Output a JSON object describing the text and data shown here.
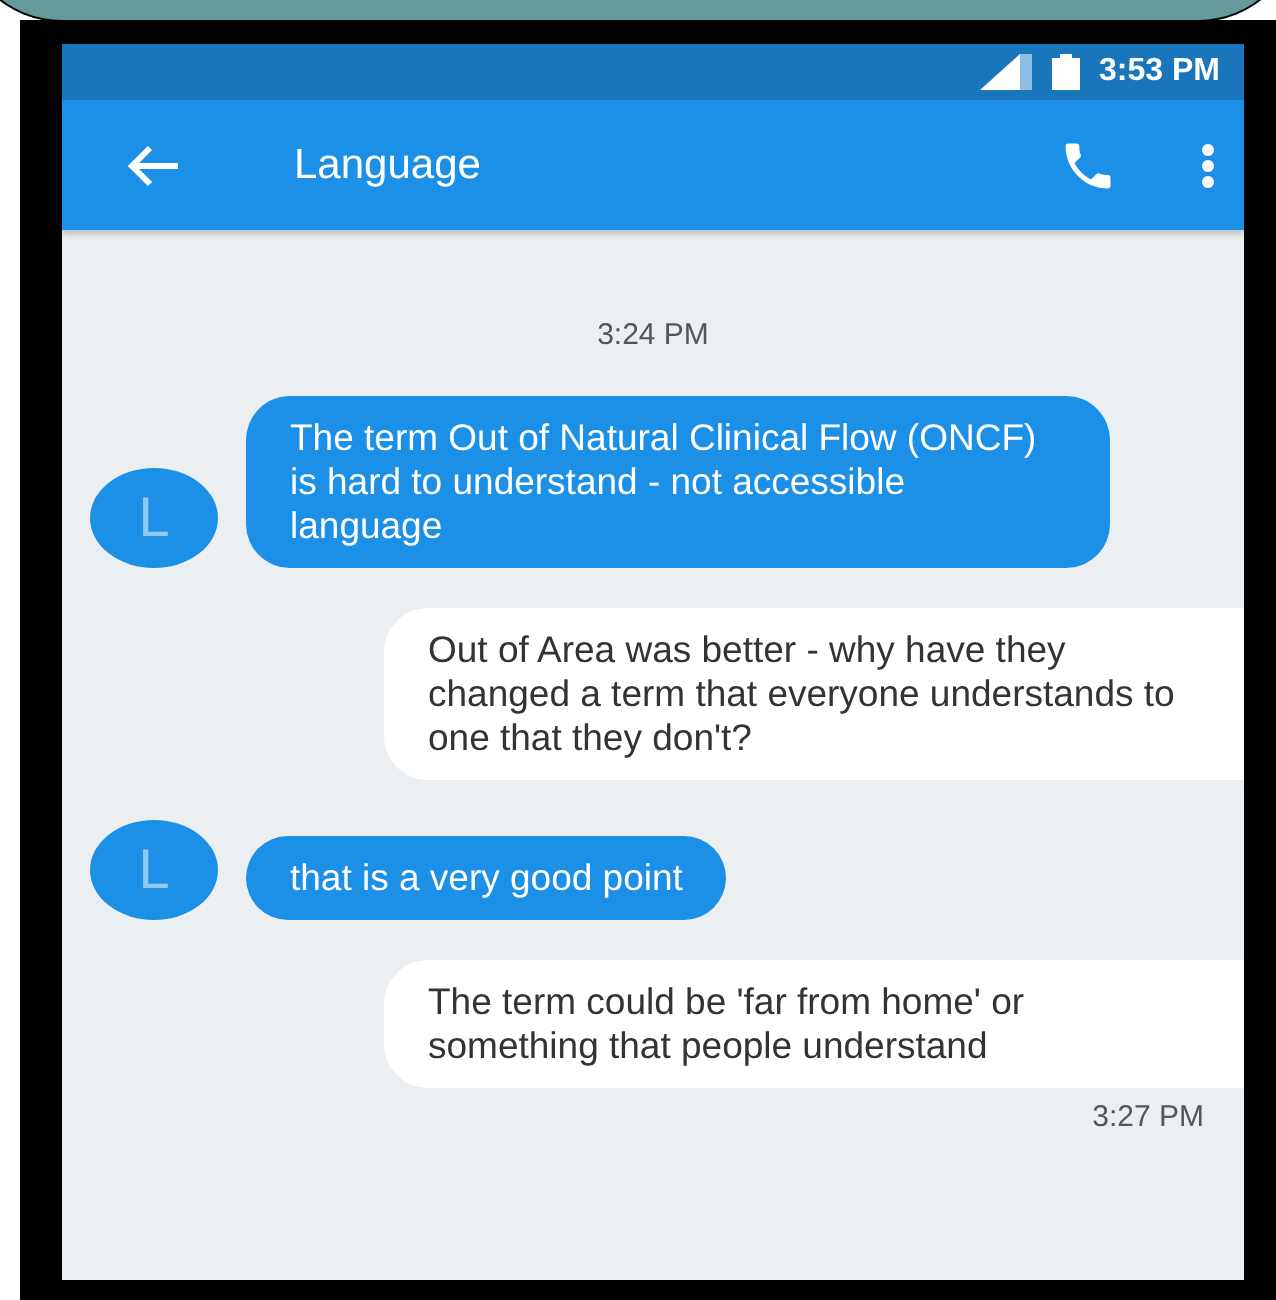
{
  "status_bar": {
    "time": "3:53 PM"
  },
  "app_bar": {
    "title": "Language"
  },
  "messages": [
    {
      "kind": "time",
      "text": "3:24 PM"
    },
    {
      "kind": "incoming",
      "avatar": "L",
      "text": "The term Out of Natural Clinical Flow (ONCF) is hard to understand - not accessible language"
    },
    {
      "kind": "outgoing",
      "text": "Out of Area was better - why have they changed a term that everyone understands to one that they don't?"
    },
    {
      "kind": "incoming",
      "avatar": "L",
      "text": "that is a very good point"
    },
    {
      "kind": "outgoing",
      "text": "The term could be 'far from home' or something that people understand"
    },
    {
      "kind": "stamp",
      "text": "3:27 PM"
    }
  ]
}
